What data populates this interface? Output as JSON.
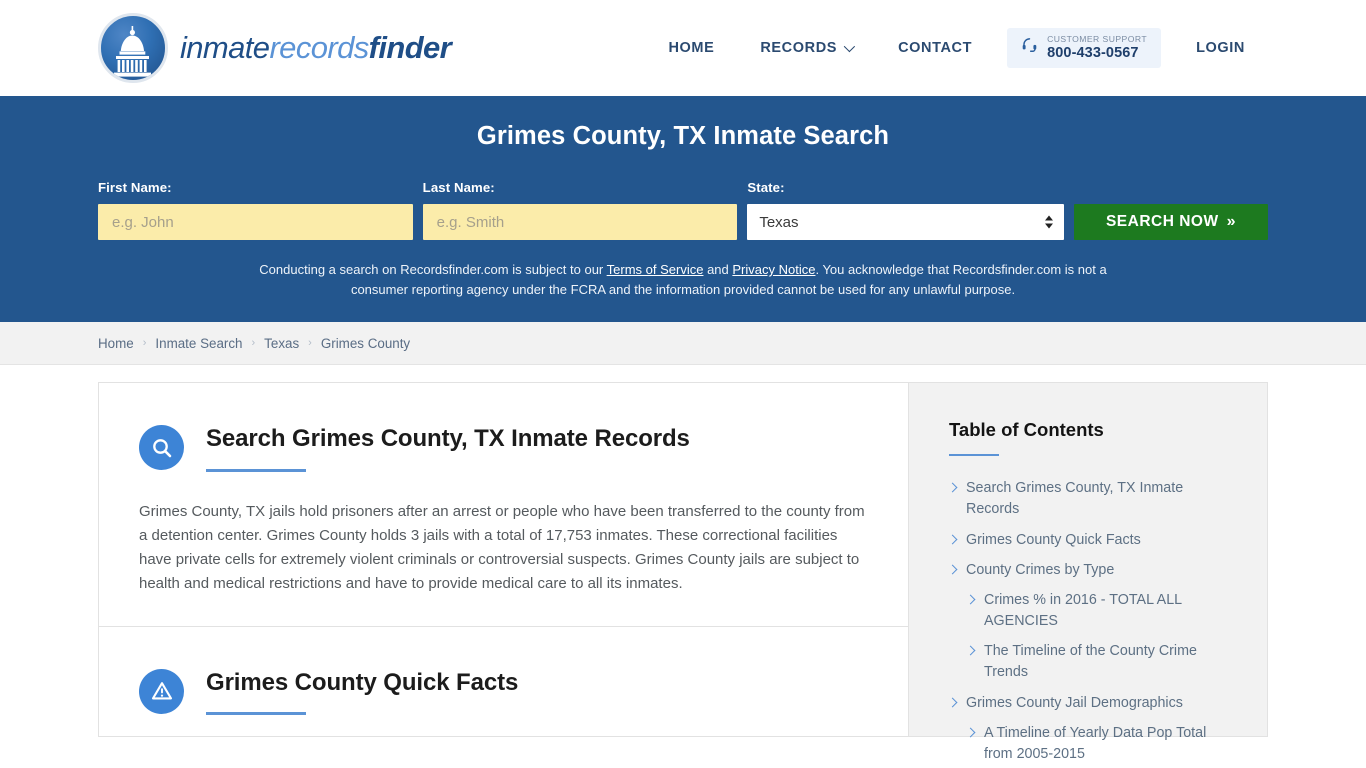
{
  "header": {
    "logo": {
      "part1": "inmate",
      "part2": "records",
      "part3": "finder",
      "icon": "capitol-dome-icon"
    },
    "nav": [
      {
        "label": "HOME",
        "has_caret": false
      },
      {
        "label": "RECORDS",
        "has_caret": true
      },
      {
        "label": "CONTACT",
        "has_caret": false
      }
    ],
    "support": {
      "icon": "headset-icon",
      "label": "CUSTOMER SUPPORT",
      "phone": "800-433-0567"
    },
    "login_label": "LOGIN"
  },
  "hero": {
    "title": "Grimes County, TX Inmate Search",
    "fields": {
      "first_name_label": "First Name:",
      "first_name_placeholder": "e.g. John",
      "first_name_value": "",
      "last_name_label": "Last Name:",
      "last_name_placeholder": "e.g. Smith",
      "last_name_value": "",
      "state_label": "State:",
      "state_value": "Texas",
      "state_options": [
        "Texas"
      ]
    },
    "search_button": "SEARCH NOW",
    "search_button_chevron": "»",
    "disclaimer": {
      "text_1": "Conducting a search on Recordsfinder.com is subject to our ",
      "link_1": "Terms of Service",
      "text_2": " and ",
      "link_2": "Privacy Notice",
      "text_3": ". You acknowledge that Recordsfinder.com is not a consumer reporting agency under the FCRA and the information provided cannot be used for any unlawful purpose."
    }
  },
  "breadcrumb": {
    "items": [
      "Home",
      "Inmate Search",
      "Texas",
      "Grimes County"
    ],
    "separator": "›"
  },
  "main": {
    "sections": [
      {
        "icon": "magnifier-icon",
        "title": "Search Grimes County, TX Inmate Records",
        "body": "Grimes County, TX jails hold prisoners after an arrest or people who have been transferred to the county from a detention center. Grimes County holds 3 jails with a total of 17,753 inmates. These correctional facilities have private cells for extremely violent criminals or controversial suspects. Grimes County jails are subject to health and medical restrictions and have to provide medical care to all its inmates."
      },
      {
        "icon": "warning-triangle-icon",
        "title": "Grimes County Quick Facts",
        "body": ""
      }
    ]
  },
  "toc": {
    "title": "Table of Contents",
    "items": [
      {
        "label": "Search Grimes County, TX Inmate Records",
        "level": 1
      },
      {
        "label": "Grimes County Quick Facts",
        "level": 1
      },
      {
        "label": "County Crimes by Type",
        "level": 1
      },
      {
        "label": "Crimes % in 2016 - TOTAL ALL AGENCIES",
        "level": 2
      },
      {
        "label": "The Timeline of the County Crime Trends",
        "level": 2
      },
      {
        "label": "Grimes County Jail Demographics",
        "level": 1
      },
      {
        "label": "A Timeline of Yearly Data Pop Total from 2005-2015",
        "level": 2
      }
    ]
  },
  "colors": {
    "hero_blue": "#23568e",
    "accent_blue": "#5b93d6",
    "icon_blue": "#3d84d6",
    "button_green": "#1d7a1f",
    "input_yellow": "#fbecaa",
    "panel_gray": "#f2f2f2"
  }
}
